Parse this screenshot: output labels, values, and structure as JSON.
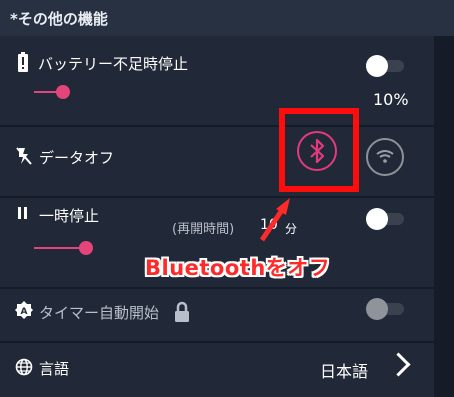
{
  "section_title": "*その他の機能",
  "battery": {
    "label": "バッテリー不足時停止",
    "value": "10%",
    "slider_fraction": 0.05,
    "toggle_on": true
  },
  "data_off": {
    "label": "データオフ"
  },
  "pause": {
    "label": "一時停止",
    "resume_label": "(再開時間)",
    "resume_value": "10",
    "resume_unit": "分",
    "slider_fraction": 0.1,
    "toggle_on": true
  },
  "timer_autostart": {
    "label": "タイマー自動開始",
    "toggle_on": false,
    "locked": true
  },
  "language": {
    "label": "言語",
    "value": "日本語"
  },
  "annotation": {
    "text": "Bluetoothをオフ",
    "color": "#ff2a2a"
  },
  "colors": {
    "accent": "#e3457a",
    "highlight": "#ff0d0d"
  },
  "icons": [
    "battery-alert-icon",
    "flash-off-icon",
    "pause-icon",
    "auto-icon",
    "lock-icon",
    "globe-icon",
    "bluetooth-icon",
    "wifi-icon",
    "chevron-right-icon",
    "arrow-icon"
  ]
}
